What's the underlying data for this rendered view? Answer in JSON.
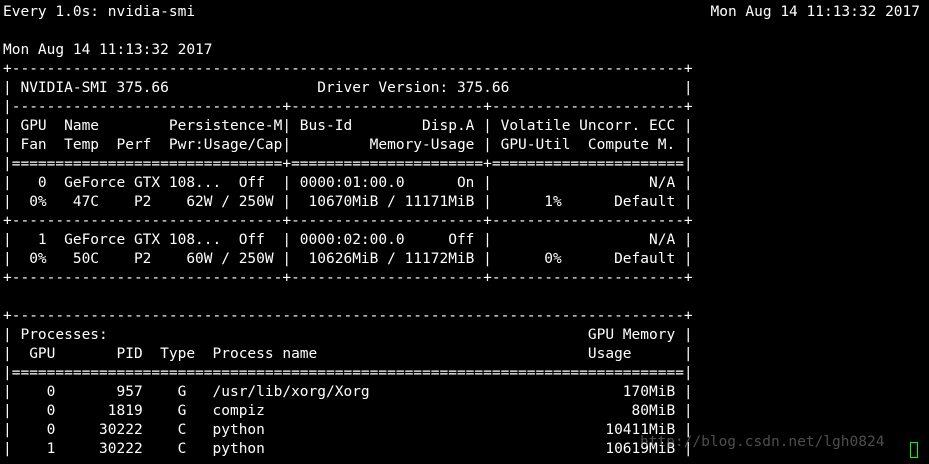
{
  "watch": {
    "header_left": "Every 1.0s: nvidia-smi",
    "header_right": "Mon Aug 14 11:13:32 2017"
  },
  "smi": {
    "timestamp": "Mon Aug 14 11:13:32 2017",
    "border_top": "+-----------------------------------------------------------------------------+",
    "version_line": "| NVIDIA-SMI 375.66                 Driver Version: 375.66                    |",
    "divider": "|-------------------------------+----------------------+----------------------+",
    "header_line_1": "| GPU  Name        Persistence-M| Bus-Id        Disp.A | Volatile Uncorr. ECC |",
    "header_line_2": "| Fan  Temp  Perf  Pwr:Usage/Cap|         Memory-Usage | GPU-Util  Compute M. |",
    "double_divider": "|===============================+======================+======================|",
    "gpus": [
      {
        "line_1": "|   0  GeForce GTX 108...  Off  | 0000:01:00.0      On |                  N/A |",
        "line_2": "|  0%   47C    P2    62W / 250W |  10670MiB / 11171MiB |      1%      Default |"
      },
      {
        "line_1": "|   1  GeForce GTX 108...  Off  | 0000:02:00.0     Off |                  N/A |",
        "line_2": "|  0%   50C    P2    60W / 250W |  10626MiB / 11172MiB |      0%      Default |"
      }
    ],
    "gpu_border": "+-------------------------------+----------------------+----------------------+"
  },
  "processes": {
    "border_top": "+-----------------------------------------------------------------------------+",
    "title_line": "| Processes:                                                       GPU Memory |",
    "header_line": "|  GPU       PID  Type  Process name                               Usage      |",
    "double_divider": "|=============================================================================|",
    "rows": [
      "|    0       957    G   /usr/lib/xorg/Xorg                             170MiB |",
      "|    0      1819    G   compiz                                          80MiB |",
      "|    0     30222    C   python                                       10411MiB |",
      "|    1     30222    C   python                                       10619MiB |"
    ]
  },
  "watermark": "http://blog.csdn.net/lgh0824",
  "colors": {
    "background": "#000000",
    "text": "#ffffff",
    "cursor": "#00ff00"
  }
}
